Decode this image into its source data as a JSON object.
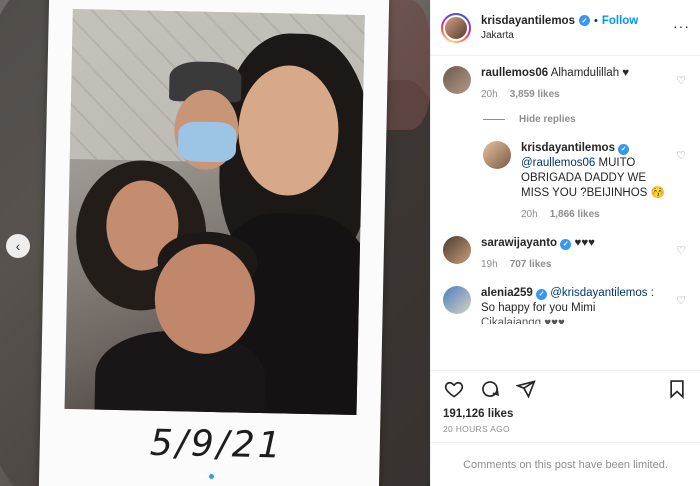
{
  "post": {
    "date_caption": "5/9/21",
    "prev_glyph": "‹"
  },
  "header": {
    "username": "krisdayantilemos",
    "verified_glyph": "✓",
    "separator": "•",
    "follow_label": "Follow",
    "location": "Jakarta",
    "more_glyph": "···"
  },
  "comments": [
    {
      "username": "raullemos06",
      "text": "Alhamdulillah ♥",
      "time": "20h",
      "likes": "3,859 likes"
    }
  ],
  "hide_replies_label": "Hide replies",
  "reply": {
    "username": "krisdayantilemos",
    "mention": "@raullemos06",
    "text": " MUITO OBRIGADA DADDY WE MISS YOU ?BEIJINHOS 😚",
    "time": "20h",
    "likes": "1,866 likes"
  },
  "comment2": {
    "username": "sarawijayanto",
    "text": "♥♥♥",
    "time": "19h",
    "likes": "707 likes"
  },
  "comment3": {
    "username": "alenia259",
    "mention": "@krisdayantilemos",
    "text": " : So happy for you Mimi",
    "cut_text": "Cikalaiangg ♥♥♥"
  },
  "likes_count": "191,126 likes",
  "timestamp": "20 HOURS AGO",
  "limited_notice": "Comments on this post have been limited.",
  "icons": {
    "like": "heart-icon",
    "comment": "comment-icon",
    "share": "share-icon",
    "save": "bookmark-icon"
  },
  "colors": {
    "follow": "#0095f6",
    "verified": "#3897f0",
    "muted": "#8e8e8e"
  }
}
